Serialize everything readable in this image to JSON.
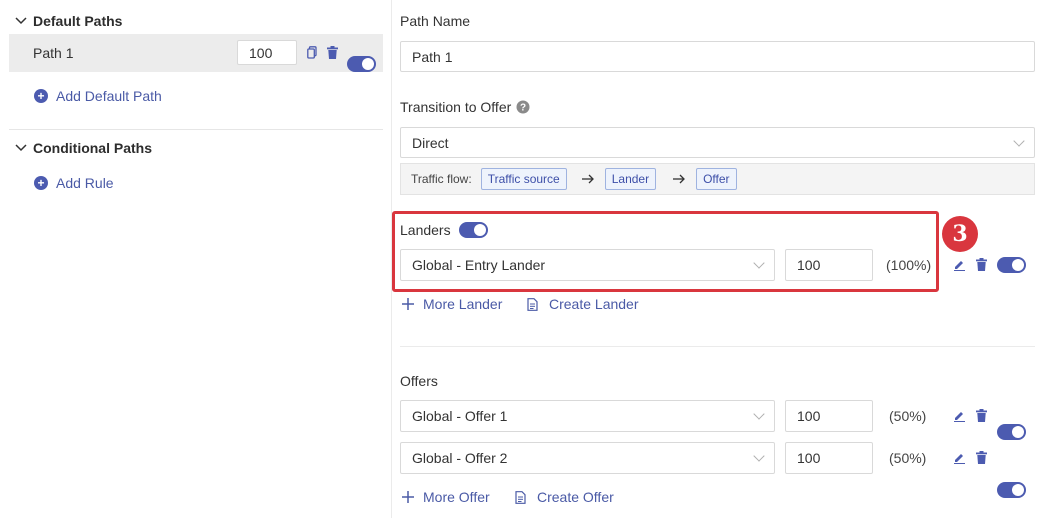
{
  "left": {
    "default_paths_title": "Default Paths",
    "path_item": {
      "label": "Path 1",
      "weight": "100"
    },
    "add_default_path": "Add Default Path",
    "conditional_paths_title": "Conditional Paths",
    "add_rule": "Add Rule"
  },
  "right": {
    "path_name_label": "Path Name",
    "path_name_value": "Path 1",
    "transition_label": "Transition to Offer",
    "transition_value": "Direct",
    "traffic_flow_label": "Traffic flow:",
    "traffic_flow": [
      "Traffic source",
      "Lander",
      "Offer"
    ],
    "landers_label": "Landers",
    "landers": [
      {
        "name": "Global - Entry Lander",
        "weight": "100",
        "percent": "(100%)"
      }
    ],
    "more_lander": "More Lander",
    "create_lander": "Create Lander",
    "badge": "3",
    "offers_label": "Offers",
    "offers": [
      {
        "name": "Global - Offer 1",
        "weight": "100",
        "percent": "(50%)"
      },
      {
        "name": "Global - Offer 2",
        "weight": "100",
        "percent": "(50%)"
      }
    ],
    "more_offer": "More Offer",
    "create_offer": "Create Offer"
  },
  "colors": {
    "accent": "#4c5bb0",
    "highlight_border": "#d9363e",
    "badge_bg": "#d9363e"
  }
}
